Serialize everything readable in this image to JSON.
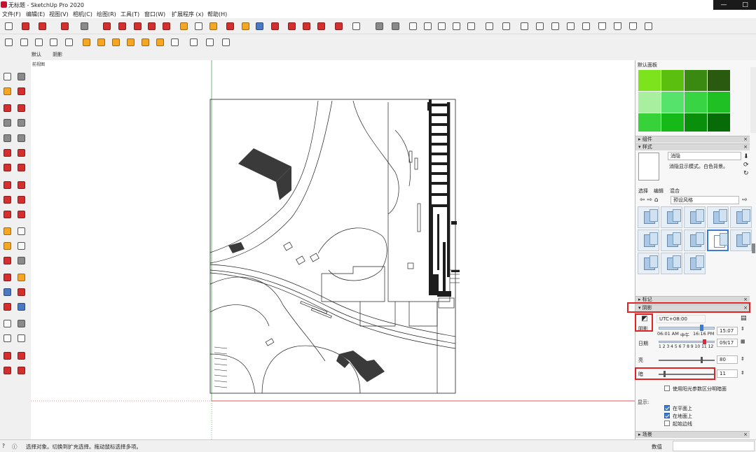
{
  "window": {
    "title": "无标题 - SketchUp Pro 2020",
    "min": "—",
    "max": "□"
  },
  "menu": [
    "文件(F)",
    "编辑(E)",
    "视图(V)",
    "相机(C)",
    "绘图(R)",
    "工具(T)",
    "窗口(W)",
    "扩展程序 (x)",
    "帮助(H)"
  ],
  "tabs": [
    "默认",
    "阴影"
  ],
  "viewport": {
    "label": "前视图"
  },
  "panel": {
    "title": "默认面板",
    "colors": [
      "#7de31c",
      "#5bbf0f",
      "#3a8a12",
      "#2a5a10",
      "#a8f0a0",
      "#55e36b",
      "#39d444",
      "#1fc024",
      "#37d13a",
      "#15b918",
      "#0a8f0c",
      "#076b08"
    ],
    "components": {
      "label": "组件"
    },
    "styles": {
      "label": "样式",
      "name": "消隐",
      "desc": "消隐显示模式。白色背景。",
      "tabs": [
        "选择",
        "编辑",
        "混合"
      ],
      "collection": "预设风格"
    },
    "tags": {
      "label": "标记"
    },
    "shadows": {
      "label": "阴影",
      "icon_label": "阴影",
      "timezone": "UTC+08:00",
      "time_label": "时间",
      "time_left": "06:01 AM",
      "time_mid": "中午",
      "time_right": "16:16 PM",
      "time_value": "15:07",
      "date_label": "日期",
      "months": "1 2 3 4 5 6 7 8 9 10 11 12",
      "date_value": "09/17",
      "light_label": "亮",
      "light_value": 80,
      "dark_label": "暗",
      "dark_value": 11,
      "use_sun": "使用阳光参数区分明暗面",
      "display_label": "显示:",
      "on_faces": "在平面上",
      "on_ground": "在地面上",
      "from_edges": "起始边线",
      "on_faces_checked": true,
      "on_ground_checked": true,
      "from_edges_checked": false,
      "use_sun_checked": false
    },
    "scenes": {
      "label": "场景"
    }
  },
  "status": {
    "text": "选择对象。切换到扩充选择。拖动鼠标选择多项。",
    "measure_label": "数值"
  }
}
